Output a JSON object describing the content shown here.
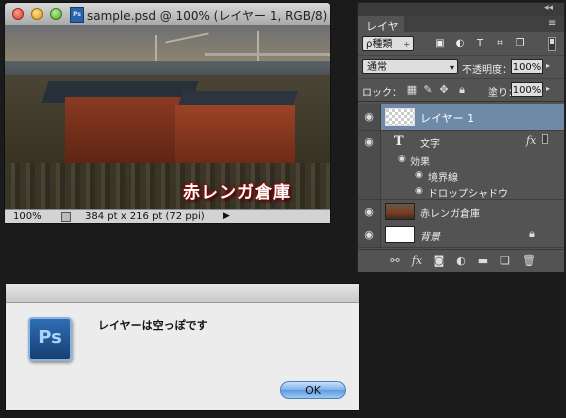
{
  "document_window": {
    "title": "sample.psd @ 100% (レイヤー 1, RGB/8)",
    "file_icon_text": "Ps",
    "canvas_caption": "赤レンガ倉庫",
    "status": {
      "zoom": "100%",
      "doc_info": "384 pt x 216 pt (72 ppi)",
      "arrow": "▶"
    }
  },
  "layers_panel": {
    "tab_label": "レイヤー",
    "collapse_glyph": "◂◂",
    "menu_glyph": "≡",
    "filter": {
      "kind_label": "ρ種類",
      "kind_arrow": "÷"
    },
    "blend_mode": "通常",
    "opacity_label": "不透明度：",
    "opacity_value": "100%",
    "lock_label": "ロック：",
    "fill_label": "塗り：",
    "fill_value": "100%",
    "layers": [
      {
        "name": "レイヤー 1",
        "selected": true
      },
      {
        "name": "文字",
        "fx": "fx",
        "effects_label": "効果",
        "effects": [
          "境界線",
          "ドロップシャドウ"
        ]
      },
      {
        "name": "赤レンガ倉庫"
      },
      {
        "name": "背景",
        "locked": true
      }
    ],
    "eye_glyph": "◉"
  },
  "dialog": {
    "message": "レイヤーは空っぽです",
    "ok_label": "OK",
    "icon_text": "Ps"
  },
  "colors": {
    "selected_layer": "#6f8aa6",
    "panel_bg": "#535353",
    "ok_button": "#7fb1ea",
    "caption_glow": "#8a0e0e"
  },
  "icons": [
    "search-icon",
    "pixel-filter-icon",
    "adjustment-filter-icon",
    "type-filter-icon",
    "shape-filter-icon",
    "smart-object-filter-icon",
    "lock-transparency-icon",
    "lock-pixels-icon",
    "lock-position-icon",
    "lock-all-icon",
    "link-icon",
    "fx-icon",
    "mask-icon",
    "adjustment-icon",
    "folder-icon",
    "new-layer-icon",
    "trash-icon"
  ]
}
